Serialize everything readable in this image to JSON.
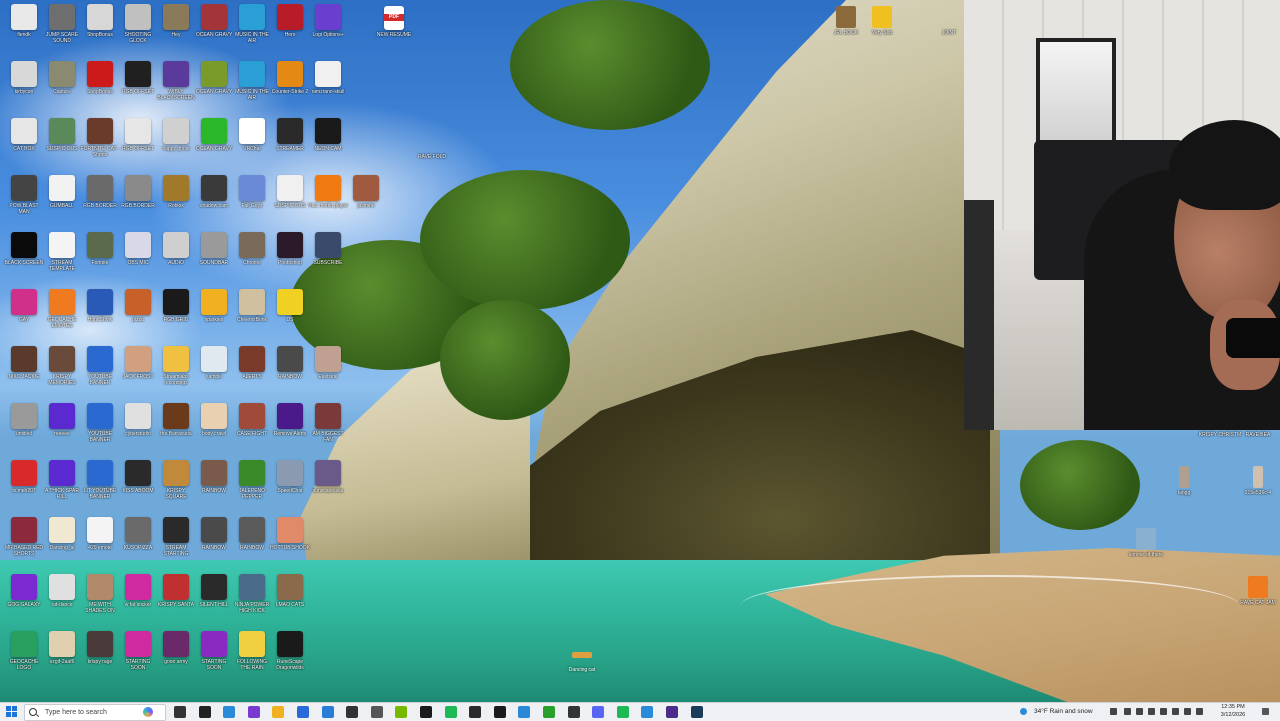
{
  "desktop": {
    "icons": [
      {
        "label": "fiendk",
        "col": 0,
        "row": 0,
        "color": "#e9e9e9"
      },
      {
        "label": "JUMP SCARE SOUND",
        "col": 1,
        "row": 0,
        "color": "#6e6e6e"
      },
      {
        "label": "ShopBonus",
        "col": 2,
        "row": 0,
        "color": "#d7d7d7"
      },
      {
        "label": "SHOOTING GLOCK",
        "col": 3,
        "row": 0,
        "color": "#c0c0c0"
      },
      {
        "label": "Hey",
        "col": 4,
        "row": 0,
        "color": "#8a7a5a"
      },
      {
        "label": "OCEAN GRAVY",
        "col": 5,
        "row": 0,
        "color": "#a2343a"
      },
      {
        "label": "MUSIC IN THE AIR",
        "col": 6,
        "row": 0,
        "color": "#2a9fd6"
      },
      {
        "label": "Hero",
        "col": 7,
        "row": 0,
        "color": "#b81c28"
      },
      {
        "label": "Logi Options+",
        "col": 8,
        "row": 0,
        "color": "#6a3fd0"
      },
      {
        "label": "kirbycon",
        "col": 0,
        "row": 1,
        "color": "#d8d8d8"
      },
      {
        "label": "Capture",
        "col": 1,
        "row": 1,
        "color": "#8a8a70"
      },
      {
        "label": "ShopBonus",
        "col": 2,
        "row": 1,
        "color": "#cc1a1a"
      },
      {
        "label": "RGB OFFSET",
        "col": 3,
        "row": 1,
        "color": "#202020"
      },
      {
        "label": "WIBLY BLACKSCREEN",
        "col": 4,
        "row": 1,
        "color": "#5a3a9a"
      },
      {
        "label": "OCEAN GRAVY",
        "col": 5,
        "row": 1,
        "color": "#7a9a2a"
      },
      {
        "label": "MUSIC IN THE AIR",
        "col": 6,
        "row": 1,
        "color": "#2a9fd6"
      },
      {
        "label": "Counter-Strike 2",
        "col": 7,
        "row": 1,
        "color": "#e48a14"
      },
      {
        "label": "ramzrano-skull",
        "col": 8,
        "row": 1,
        "color": "#f0f0f0"
      },
      {
        "label": "CAT BOX",
        "col": 0,
        "row": 2,
        "color": "#e6e6e6"
      },
      {
        "label": "SUSPICIOUS",
        "col": 1,
        "row": 2,
        "color": "#5a8a5a"
      },
      {
        "label": "FORTNITE CAT - Shorts",
        "col": 2,
        "row": 2,
        "color": "#6a3a2a"
      },
      {
        "label": "RGB OFFSET",
        "col": 3,
        "row": 2,
        "color": "#e6e6e6"
      },
      {
        "label": "happy ghost",
        "col": 4,
        "row": 2,
        "color": "#d0d0d0"
      },
      {
        "label": "OCEAN GRAVY",
        "col": 5,
        "row": 2,
        "color": "#2ab82a"
      },
      {
        "label": "VRChat",
        "col": 6,
        "row": 2,
        "color": "#ffffff"
      },
      {
        "label": "STREAMER",
        "col": 7,
        "row": 2,
        "color": "#2a2a2a"
      },
      {
        "label": "NEON CAM",
        "col": 8,
        "row": 2,
        "color": "#1a1a1a"
      },
      {
        "label": "POW BLAST MAN",
        "col": 0,
        "row": 3,
        "color": "#444444"
      },
      {
        "label": "GUMBALL",
        "col": 1,
        "row": 3,
        "color": "#f2f2f2"
      },
      {
        "label": "RGB BORDER",
        "col": 2,
        "row": 3,
        "color": "#6a6a6a"
      },
      {
        "label": "RGB BORDER",
        "col": 3,
        "row": 3,
        "color": "#8a8a8a"
      },
      {
        "label": "Roblox",
        "col": 4,
        "row": 3,
        "color": "#a07a2a"
      },
      {
        "label": "shadow cam",
        "col": 5,
        "row": 3,
        "color": "#3a3a3a"
      },
      {
        "label": "Fall Guys",
        "col": 6,
        "row": 3,
        "color": "#6a8ad8"
      },
      {
        "label": "SUSPICIOUS",
        "col": 7,
        "row": 3,
        "color": "#f0f0f0"
      },
      {
        "label": "VLC media player",
        "col": 8,
        "row": 3,
        "color": "#f07a10"
      },
      {
        "label": "jasmine",
        "col": 9,
        "row": 3,
        "color": "#a05a40"
      },
      {
        "label": "BLACK SCREEN",
        "col": 0,
        "row": 4,
        "color": "#0a0a0a"
      },
      {
        "label": "STREAM TEMPLATE",
        "col": 1,
        "row": 4,
        "color": "#f4f4f4"
      },
      {
        "label": "Fortnite",
        "col": 2,
        "row": 4,
        "color": "#5a6a4a"
      },
      {
        "label": "OBS MIC",
        "col": 3,
        "row": 4,
        "color": "#d8d8e8"
      },
      {
        "label": "AUDIO",
        "col": 4,
        "row": 4,
        "color": "#cfcfcf"
      },
      {
        "label": "SOUNDBAR",
        "col": 5,
        "row": 4,
        "color": "#9a9a9a"
      },
      {
        "label": "Chrome",
        "col": 6,
        "row": 4,
        "color": "#7a6a5a"
      },
      {
        "label": "Photoshop",
        "col": 7,
        "row": 4,
        "color": "#2a1a2a"
      },
      {
        "label": "SUBSCRIBE",
        "col": 8,
        "row": 4,
        "color": "#3a4a6a"
      },
      {
        "label": "GAY",
        "col": 0,
        "row": 5,
        "color": "#d0308a"
      },
      {
        "label": "GEOCACHE EMOTES",
        "col": 1,
        "row": 5,
        "color": "#f07a20"
      },
      {
        "label": "Hunt:Show",
        "col": 2,
        "row": 5,
        "color": "#2a5ab8"
      },
      {
        "label": "pizza",
        "col": 3,
        "row": 5,
        "color": "#c8602a"
      },
      {
        "label": "RGB GRID",
        "col": 4,
        "row": 5,
        "color": "#1a1a1a"
      },
      {
        "label": "sparkles",
        "col": 5,
        "row": 5,
        "color": "#f0b020"
      },
      {
        "label": "CheemsBonk",
        "col": 6,
        "row": 5,
        "color": "#d0c0a0"
      },
      {
        "label": "DS",
        "col": 7,
        "row": 5,
        "color": "#f0d020"
      },
      {
        "label": "NIKO JACKIE",
        "col": 0,
        "row": 6,
        "color": "#5a3a2a"
      },
      {
        "label": "KRISPY MEMORIES",
        "col": 1,
        "row": 6,
        "color": "#6a4a3a"
      },
      {
        "label": "YOUTUBE BANNER",
        "col": 2,
        "row": 6,
        "color": "#2a6ad0"
      },
      {
        "label": "JACK FROST",
        "col": 3,
        "row": 6,
        "color": "#d0a080"
      },
      {
        "label": "Streamlabs recordings",
        "col": 4,
        "row": 6,
        "color": "#f0c040"
      },
      {
        "label": "sample",
        "col": 5,
        "row": 6,
        "color": "#e0e8f0"
      },
      {
        "label": "ALERTS",
        "col": 6,
        "row": 6,
        "color": "#7a3a2a"
      },
      {
        "label": "RAINBOW",
        "col": 7,
        "row": 6,
        "color": "#4a4a4a"
      },
      {
        "label": "Eastside",
        "col": 8,
        "row": 6,
        "color": "#c0a090"
      },
      {
        "label": "untitled",
        "col": 0,
        "row": 7,
        "color": "#9a9a9a"
      },
      {
        "label": "reeeee",
        "col": 1,
        "row": 7,
        "color": "#5a2ad0"
      },
      {
        "label": "YOUTUBE BANNER",
        "col": 2,
        "row": 7,
        "color": "#2a6ad0"
      },
      {
        "label": "cyberstudio",
        "col": 3,
        "row": 7,
        "color": "#e0e0e0"
      },
      {
        "label": "the Barracuda",
        "col": 4,
        "row": 7,
        "color": "#6a3a1a"
      },
      {
        "label": "body crawl",
        "col": 5,
        "row": 7,
        "color": "#e8d0b0"
      },
      {
        "label": "CASE FIGHT",
        "col": 6,
        "row": 7,
        "color": "#a04a3a"
      },
      {
        "label": "Remove Alerts",
        "col": 7,
        "row": 7,
        "color": "#4a1a8a"
      },
      {
        "label": "AM BIGGEST FAN",
        "col": 8,
        "row": 7,
        "color": "#7a3a3a"
      },
      {
        "label": "ts.meh207",
        "col": 0,
        "row": 8,
        "color": "#d82a2a"
      },
      {
        "label": "A THICK SPAR RILL",
        "col": 1,
        "row": 8,
        "color": "#5a2ad0"
      },
      {
        "label": "LIT YOUTUBE BANNER",
        "col": 2,
        "row": 8,
        "color": "#2a6ad0"
      },
      {
        "label": "KISS ABOOM",
        "col": 3,
        "row": 8,
        "color": "#2a2a2a"
      },
      {
        "label": "KRISPY SQUARE",
        "col": 4,
        "row": 8,
        "color": "#c08a3a"
      },
      {
        "label": "RAINBOW",
        "col": 5,
        "row": 8,
        "color": "#7a5a4a"
      },
      {
        "label": "JALEPENO PEPPER",
        "col": 6,
        "row": 8,
        "color": "#3a8a2a"
      },
      {
        "label": "SpeedChat",
        "col": 7,
        "row": 8,
        "color": "#8a9ab0"
      },
      {
        "label": "sunscapeasia",
        "col": 8,
        "row": 8,
        "color": "#6a5a8a"
      },
      {
        "label": "MR BASED RED SHORTS",
        "col": 0,
        "row": 9,
        "color": "#8a2a3a"
      },
      {
        "label": "Dancing_ai",
        "col": 1,
        "row": 9,
        "color": "#f0e8d0"
      },
      {
        "label": "420 emote",
        "col": 2,
        "row": 9,
        "color": "#f4f4f4"
      },
      {
        "label": "KUSOPIZZA",
        "col": 3,
        "row": 9,
        "color": "#6a6a6a"
      },
      {
        "label": "STREAM STARTING",
        "col": 4,
        "row": 9,
        "color": "#2a2a2a"
      },
      {
        "label": "RAINBOW",
        "col": 5,
        "row": 9,
        "color": "#4a4a4a"
      },
      {
        "label": "RAINBOW",
        "col": 6,
        "row": 9,
        "color": "#5a5a5a"
      },
      {
        "label": "HOTTUB SHOOK",
        "col": 7,
        "row": 9,
        "color": "#e08a6a"
      },
      {
        "label": "GOG GALAXY",
        "col": 0,
        "row": 10,
        "color": "#7a2ad0"
      },
      {
        "label": "rat-dance",
        "col": 1,
        "row": 10,
        "color": "#e0e0e0"
      },
      {
        "label": "ME WITH SHADES ON",
        "col": 2,
        "row": 10,
        "color": "#b08a6a"
      },
      {
        "label": "w fat sticker",
        "col": 3,
        "row": 10,
        "color": "#d02aa0"
      },
      {
        "label": "KRISPY SANTA",
        "col": 4,
        "row": 10,
        "color": "#c03030"
      },
      {
        "label": "SILENT HILL",
        "col": 5,
        "row": 10,
        "color": "#2a2a2a"
      },
      {
        "label": "NINJA POWER HIGH KICK",
        "col": 6,
        "row": 10,
        "color": "#4a6a8a"
      },
      {
        "label": "LMAO CATS",
        "col": 7,
        "row": 10,
        "color": "#8a6a4a"
      },
      {
        "label": "GEOCACHE LOGO",
        "col": 0,
        "row": 11,
        "color": "#2aa060"
      },
      {
        "label": "ezgif-2aaf6",
        "col": 1,
        "row": 11,
        "color": "#e0d0b0"
      },
      {
        "label": "krispy rage",
        "col": 2,
        "row": 11,
        "color": "#4a3a3a"
      },
      {
        "label": "STARTING SOON",
        "col": 3,
        "row": 11,
        "color": "#d02aa0"
      },
      {
        "label": "goon army",
        "col": 4,
        "row": 11,
        "color": "#6a2a6a"
      },
      {
        "label": "STARTING SOON",
        "col": 5,
        "row": 11,
        "color": "#8a2ac0"
      },
      {
        "label": "FOLLOWING THE RAIN",
        "col": 6,
        "row": 11,
        "color": "#f0d040"
      },
      {
        "label": "RuneScape Dragonwilds",
        "col": 7,
        "row": 11,
        "color": "#1a1a1a"
      }
    ],
    "pdf_icon": {
      "label": "NEW RESUME",
      "color": "#d42a2a"
    },
    "misc_icon": {
      "label": "RAVE FOLD"
    },
    "top_icons": [
      {
        "label": "JRL BOOK",
        "color": "#8a6a3a"
      },
      {
        "label": "Very Sob",
        "color": "#f0c020"
      },
      {
        "label": "JOINT",
        "color": "#9a9a9a"
      }
    ],
    "right_icons": [
      {
        "label": "KRISPY CHRISTM",
        "color": "#a02a2a"
      },
      {
        "label": "RAVE BEA",
        "color": "#e0e0e0"
      },
      {
        "label": "tangg",
        "color": "#b0a090"
      },
      {
        "label": "315e536c-4",
        "color": "#d0c0b0"
      },
      {
        "label": "lemme sit there",
        "color": "#8ab0d0"
      },
      {
        "label": "RAVE CAT JAM",
        "color": "#f07a20"
      }
    ],
    "floating_label": "Dancing cat"
  },
  "taskbar": {
    "search_placeholder": "Type here to search",
    "apps": [
      {
        "name": "task-view-icon",
        "color": "#333333"
      },
      {
        "name": "alienware-icon",
        "color": "#222222"
      },
      {
        "name": "edge-icon",
        "color": "#2a8ad8"
      },
      {
        "name": "streamlabs-icon",
        "color": "#7a3ad0"
      },
      {
        "name": "file-explorer-icon",
        "color": "#f0b020"
      },
      {
        "name": "store-icon",
        "color": "#2a6ad8"
      },
      {
        "name": "mail-icon",
        "color": "#2a7ad8"
      },
      {
        "name": "alienware-command-icon",
        "color": "#333333"
      },
      {
        "name": "gear-icon",
        "color": "#555555"
      },
      {
        "name": "nvidia-icon",
        "color": "#76b900"
      },
      {
        "name": "github-icon",
        "color": "#1a1a1a"
      },
      {
        "name": "spotify-icon",
        "color": "#1db954"
      },
      {
        "name": "terminal-icon",
        "color": "#2a2a2a"
      },
      {
        "name": "capcut-icon",
        "color": "#1a1a1a"
      },
      {
        "name": "file-icon",
        "color": "#2a8ad8"
      },
      {
        "name": "chrome-icon",
        "color": "#2aa02a"
      },
      {
        "name": "obs-icon",
        "color": "#333333"
      },
      {
        "name": "discord-icon",
        "color": "#5865f2"
      },
      {
        "name": "spotify-alt-icon",
        "color": "#1db954"
      },
      {
        "name": "vscode-icon",
        "color": "#2a8ad8"
      },
      {
        "name": "obs-studio-icon",
        "color": "#4a2a8a"
      },
      {
        "name": "steam-icon",
        "color": "#1a3a5a"
      }
    ],
    "weather": "34°F  Rain and snow",
    "time": "12:35 PM",
    "date": "3/12/2026"
  }
}
